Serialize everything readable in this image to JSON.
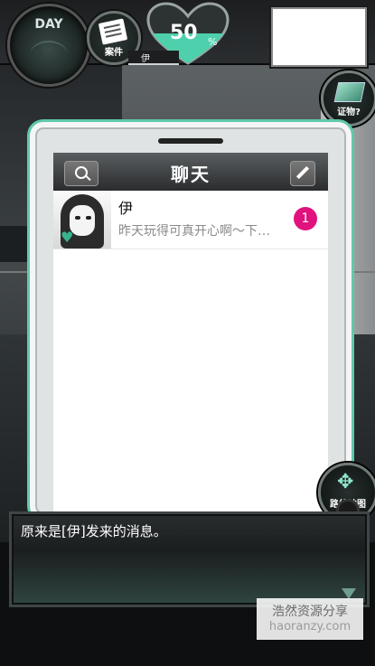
{
  "hud": {
    "day_label": "DAY",
    "memo_label": "案件",
    "heart_percent": "50",
    "heart_percent_unit": "%",
    "heart_level": 0.5,
    "character_tag": "伊",
    "evidence_label": "证物?",
    "route_map_label": "路线地图"
  },
  "phone": {
    "chat_title": "聊天",
    "messages": [
      {
        "sender": "伊",
        "preview": "昨天玩得可真开心啊～下…",
        "unread": "1"
      }
    ]
  },
  "dialog": {
    "text": "原来是[伊]发来的消息。"
  },
  "watermark": {
    "line1": "浩然资源分享",
    "line2": "haoranzy.com"
  },
  "colors": {
    "accent": "#5fc9a9",
    "unread_badge": "#e0127e",
    "heart_fill": "#4fd0ad"
  }
}
